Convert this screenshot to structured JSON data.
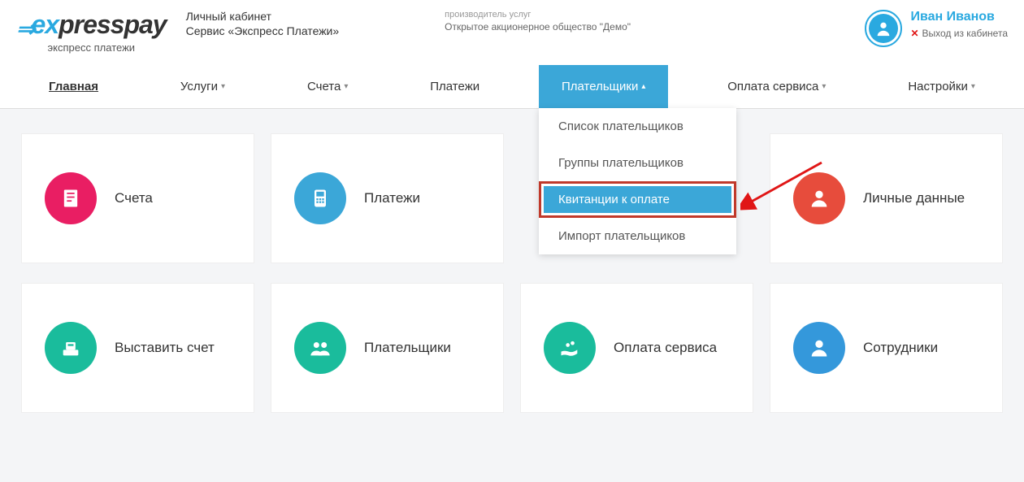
{
  "brand": {
    "ex": "ex",
    "press": "press",
    "pay": "pay",
    "sub": "экспресс платежи"
  },
  "header": {
    "line1": "Личный кабинет",
    "line2": "Сервис «Экспресс Платежи»",
    "org_label": "производитель услуг",
    "org_name": "Открытое акционерное общество \"Демо\"",
    "user_name": "Иван Иванов",
    "logout": "Выход из кабинета"
  },
  "nav": {
    "home": "Главная",
    "services": "Услуги",
    "invoices": "Счета",
    "payments": "Платежи",
    "payers": "Плательщики",
    "service_payment": "Оплата сервиса",
    "settings": "Настройки"
  },
  "dropdown": {
    "list": "Список плательщиков",
    "groups": "Группы плательщиков",
    "receipts": "Квитанции к оплате",
    "import": "Импорт плательщиков"
  },
  "cards": {
    "invoices": "Счета",
    "payments": "Платежи",
    "personal": "Личные данные",
    "issue": "Выставить счет",
    "payers": "Плательщики",
    "service_payment": "Оплата сервиса",
    "staff": "Сотрудники"
  },
  "colors": {
    "accent": "#3ba7d8"
  }
}
